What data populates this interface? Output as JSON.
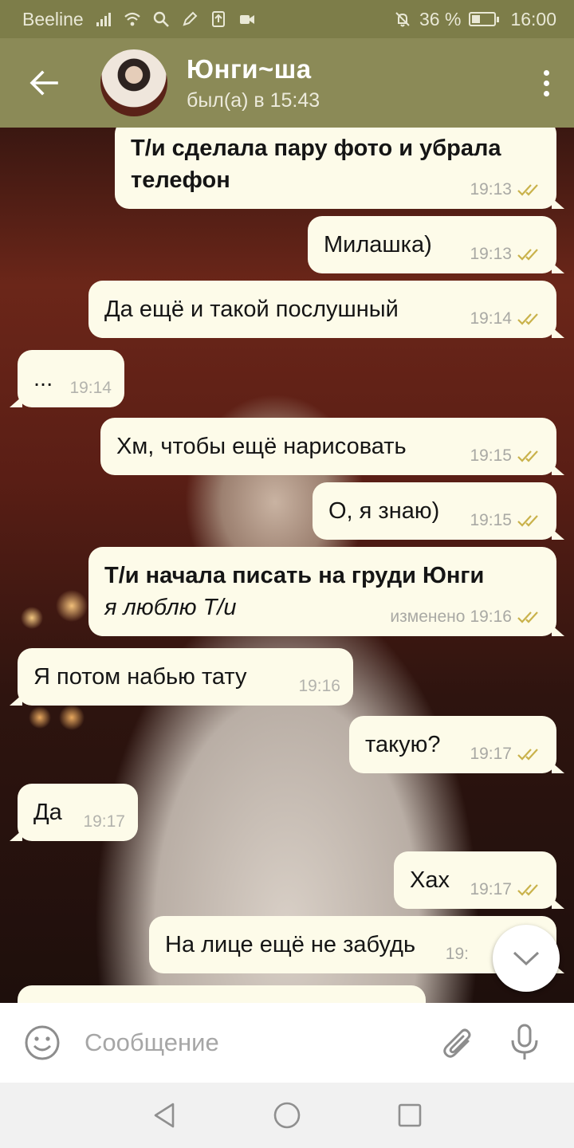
{
  "status_bar": {
    "carrier": "Beeline",
    "battery_percent": "36 %",
    "battery_level": 0.36,
    "time": "16:00",
    "icons": [
      "signal-icon",
      "wifi-icon",
      "search-icon",
      "pen-icon",
      "upload-icon",
      "video-icon",
      "mute-icon",
      "battery-icon"
    ]
  },
  "header": {
    "contact_name": "Юнги~ша",
    "contact_status": "был(а) в 15:43",
    "back_icon": "arrow-left-icon",
    "menu_icon": "more-vertical-icon"
  },
  "messages": [
    {
      "direction": "out",
      "lines": [
        "Т/и сделала пару фото и убрала",
        "телефон"
      ],
      "bold": true,
      "time": "19:13",
      "read": true
    },
    {
      "direction": "out",
      "lines": [
        "Милашка)"
      ],
      "time": "19:13",
      "read": true
    },
    {
      "direction": "out",
      "lines": [
        "Да ещё и такой послушный"
      ],
      "time": "19:14",
      "read": true
    },
    {
      "direction": "in",
      "lines": [
        "..."
      ],
      "time": "19:14"
    },
    {
      "direction": "out",
      "lines": [
        "Хм, чтобы ещё нарисовать"
      ],
      "time": "19:15",
      "read": true
    },
    {
      "direction": "out",
      "lines": [
        "О, я знаю)"
      ],
      "time": "19:15",
      "read": true
    },
    {
      "direction": "out",
      "lines": [
        "Т/и начала писать на груди Юнги",
        "я люблю Т/и"
      ],
      "edited_label": "изменено",
      "time": "19:16",
      "read": true
    },
    {
      "direction": "in",
      "lines": [
        "Я потом набью тату"
      ],
      "time": "19:16"
    },
    {
      "direction": "out",
      "lines": [
        "такую?"
      ],
      "time": "19:17",
      "read": true
    },
    {
      "direction": "in",
      "lines": [
        "Да"
      ],
      "time": "19:17"
    },
    {
      "direction": "out",
      "lines": [
        "Хах"
      ],
      "time": "19:17",
      "read": true
    },
    {
      "direction": "out",
      "lines": [
        "На лице ещё не забудь"
      ],
      "time": "19:",
      "read": true
    }
  ],
  "input": {
    "placeholder": "Сообщение"
  },
  "colors": {
    "header": "#8b8a57",
    "status_bar": "#7d7d49",
    "bubble": "#fdfbe9",
    "read_ticks": "#c9b24b"
  }
}
